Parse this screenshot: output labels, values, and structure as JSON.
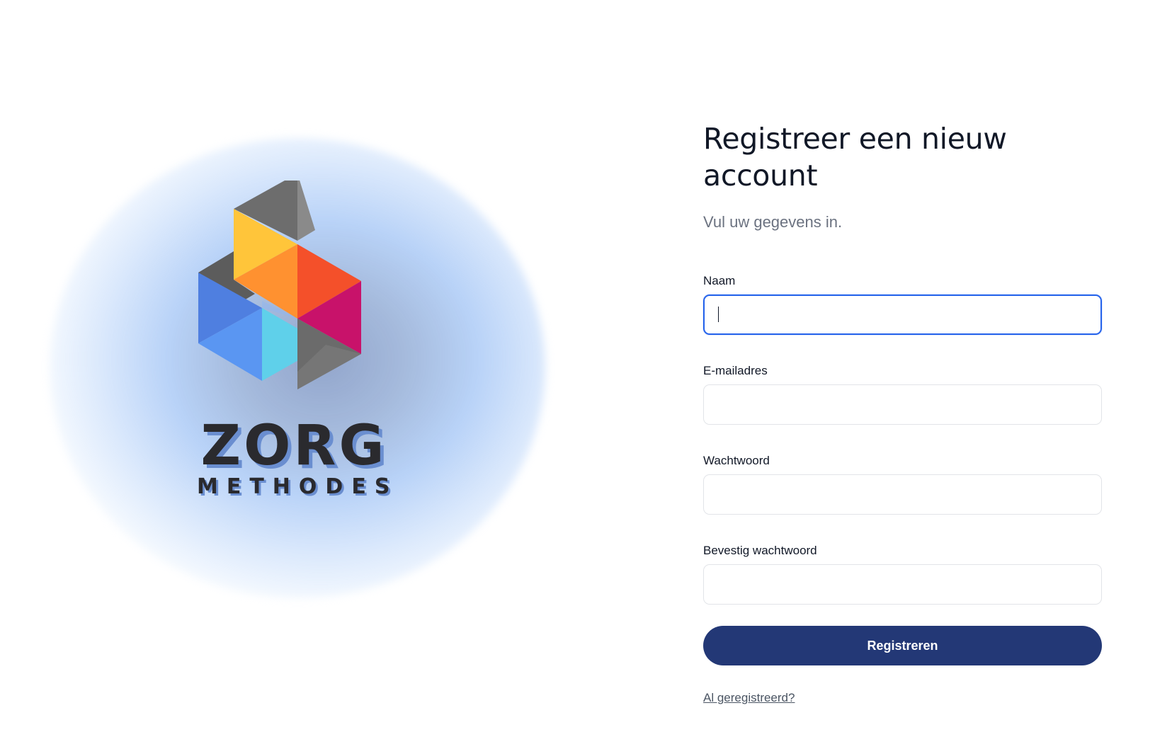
{
  "brand": {
    "name_main": "ZORG",
    "name_sub": "METHODES"
  },
  "colors": {
    "primary_button": "#233876",
    "focus_border": "#2563eb",
    "logo_gray": "#6b6b6b",
    "logo_yellow": "#ffc53a",
    "logo_orange": "#ff9130",
    "logo_red": "#f4502a",
    "logo_magenta": "#c8126a",
    "logo_blue": "#4f86e8",
    "logo_cyan": "#5fd0ea"
  },
  "form": {
    "title": "Registreer een nieuw account",
    "subtitle": "Vul uw gegevens in.",
    "fields": [
      {
        "label": "Naam",
        "value": "",
        "focused": true
      },
      {
        "label": "E-mailadres",
        "value": ""
      },
      {
        "label": "Wachtwoord",
        "value": ""
      },
      {
        "label": "Bevestig wachtwoord",
        "value": ""
      }
    ],
    "submit_label": "Registreren",
    "login_link": "Al geregistreerd?"
  }
}
